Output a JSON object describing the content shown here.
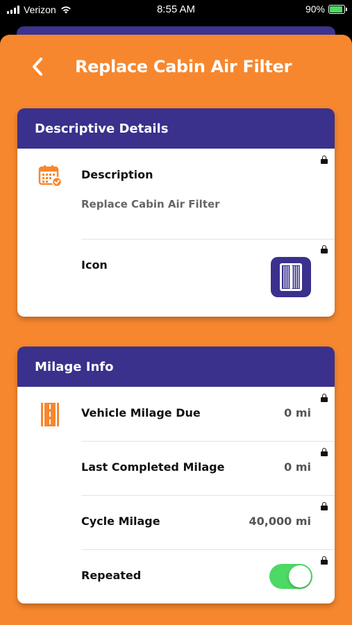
{
  "status_bar": {
    "carrier": "Verizon",
    "time": "8:55 AM",
    "battery_percent": "90%",
    "battery_level": 0.9,
    "icons": [
      "signal-icon",
      "wifi-icon",
      "battery-charging-icon"
    ]
  },
  "header": {
    "title": "Replace Cabin Air Filter",
    "back_icon": "chevron-left-icon"
  },
  "descriptive_details": {
    "heading": "Descriptive Details",
    "description_label": "Description",
    "description_value": "Replace Cabin Air Filter",
    "description_icon": "calendar-check-icon",
    "icon_label": "Icon",
    "icon_value": "air-filter-icon"
  },
  "milage_info": {
    "heading": "Milage Info",
    "section_icon": "road-icon",
    "rows": [
      {
        "label": "Vehicle Milage Due",
        "value": "0 mi"
      },
      {
        "label": "Last Completed Milage",
        "value": "0 mi"
      },
      {
        "label": "Cycle Milage",
        "value": "40,000 mi"
      }
    ],
    "repeated_label": "Repeated",
    "repeated_on": true
  },
  "colors": {
    "accent_orange": "#f7872e",
    "header_purple": "#39318c",
    "toggle_green": "#4cd964"
  }
}
